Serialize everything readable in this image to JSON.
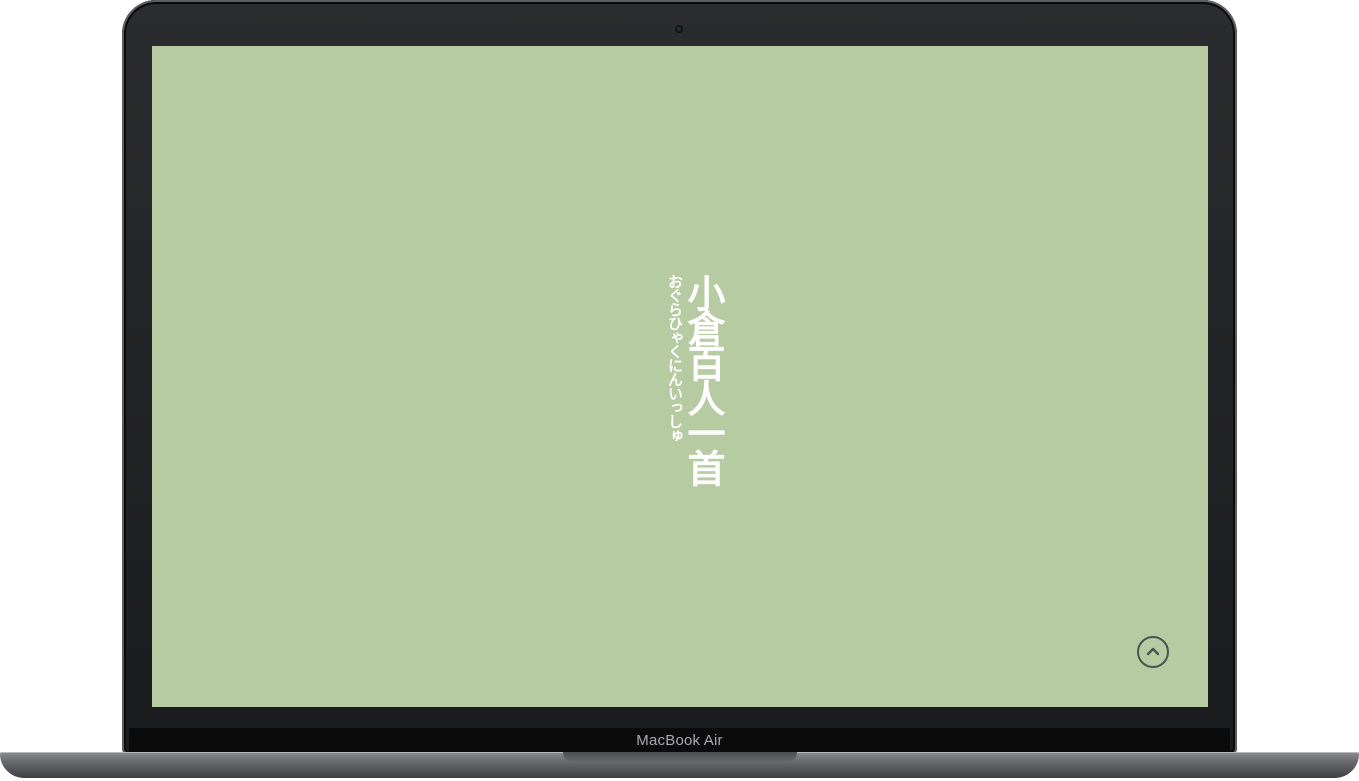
{
  "device": {
    "model_label": "MacBook Air"
  },
  "page": {
    "background_color": "#b6cba1",
    "title": {
      "kanji": "小倉百人一首",
      "ruby": "おぐらひゃくにんいっしゅ"
    },
    "scroll_top_button": {
      "icon": "chevron-up-icon"
    }
  }
}
